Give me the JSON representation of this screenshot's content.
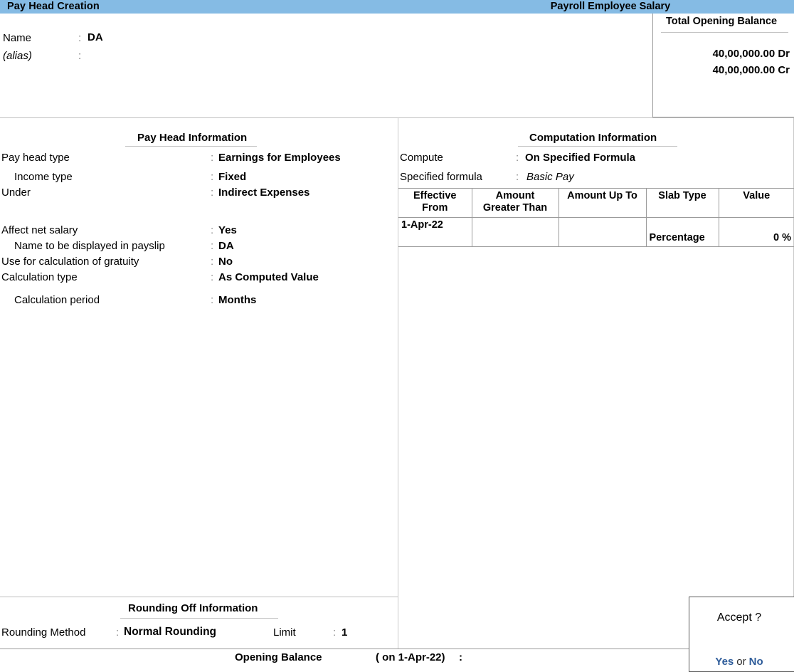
{
  "titlebar": {
    "left_title": "Pay Head  Creation",
    "right_title": "Payroll Employee Salary"
  },
  "header": {
    "name_label": "Name",
    "name_colon": ":",
    "name_value": "DA",
    "alias_label": "(alias)",
    "alias_colon": ":",
    "alias_value": ""
  },
  "opening_balance_panel": {
    "title": "Total Opening Balance",
    "debit": "40,00,000.00 Dr",
    "credit": "40,00,000.00 Cr"
  },
  "pay_head_information": {
    "heading": "Pay Head Information",
    "rows": [
      {
        "label": "Pay head type",
        "colon": ":",
        "value": "Earnings for Employees"
      },
      {
        "label": "Income type",
        "colon": ":",
        "value": "Fixed"
      },
      {
        "label": "Under",
        "colon": ":",
        "value": "Indirect Expenses"
      },
      {
        "label": "Affect net salary",
        "colon": ":",
        "value": "Yes"
      },
      {
        "label": "Name to be displayed in payslip",
        "colon": ":",
        "value": "DA"
      },
      {
        "label": "Use for calculation of gratuity",
        "colon": ":",
        "value": "No"
      },
      {
        "label": "Calculation type",
        "colon": ":",
        "value": "As Computed Value"
      },
      {
        "label": "Calculation period",
        "colon": ":",
        "value": "Months"
      }
    ]
  },
  "computation_information": {
    "heading": "Computation Information",
    "rows": [
      {
        "label": "Compute",
        "colon": ":",
        "value": "On Specified Formula"
      },
      {
        "label": "Specified formula",
        "colon": ":",
        "value": "Basic Pay"
      }
    ],
    "slab_table": {
      "columns": [
        "Effective From",
        "Amount Greater Than",
        "Amount Up To",
        "Slab Type",
        "Value"
      ],
      "columns_wrapped": [
        [
          "Effective",
          "From"
        ],
        [
          "Amount",
          "Greater Than"
        ],
        [
          "Amount Up To",
          ""
        ],
        [
          "Slab Type",
          ""
        ],
        [
          "Value",
          ""
        ]
      ],
      "rows": [
        {
          "effective_from": "1-Apr-22",
          "amount_greater_than": "",
          "amount_up_to": "",
          "slab_type": "Percentage",
          "value": "0 %"
        }
      ]
    }
  },
  "rounding_off_information": {
    "heading": "Rounding Off Information",
    "method_label": "Rounding Method",
    "method_colon": ":",
    "method_value": "Normal Rounding",
    "limit_label": "Limit",
    "limit_colon": ":",
    "limit_value": "1"
  },
  "footer": {
    "opening_balance_label": "Opening Balance",
    "on_date": "( on 1-Apr-22)",
    "colon": ":"
  },
  "accept_dialog": {
    "title": "Accept ?",
    "yes": "Yes",
    "or": "or",
    "no": "No"
  },
  "colors": {
    "titlebar_bg": "#85bbe4",
    "accent_link": "#2e5c9a",
    "rule": "#9b9b9b",
    "text": "#000000"
  }
}
